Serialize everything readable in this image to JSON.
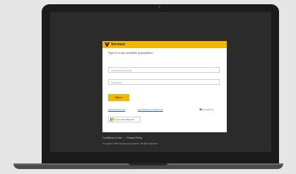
{
  "colors": {
    "brand_yellow": "#f2b705",
    "screen_bg": "#2b2b2b",
    "link_blue": "#2d5f98"
  },
  "header": {
    "logo_icon": "vermeer-logo-icon",
    "logo_text": "Vermeer"
  },
  "login": {
    "heading": "Sign in to use available applications",
    "username_placeholder": "Username or email",
    "password_placeholder": "Password",
    "sign_in_label": "Sign in",
    "forgot_password_label": "Forgot Password?",
    "new_customer_label": "New Customer? Click here",
    "contact_icon": "phone-icon",
    "contact_us_label": "Contact Us",
    "microsoft_label": "Log in with Microsoft"
  },
  "footer": {
    "terms_label": "Conditions of Use",
    "privacy_label": "Privacy Policy",
    "copyright": "Copyright © 2019 Vermeer Corporation. All rights reserved."
  }
}
